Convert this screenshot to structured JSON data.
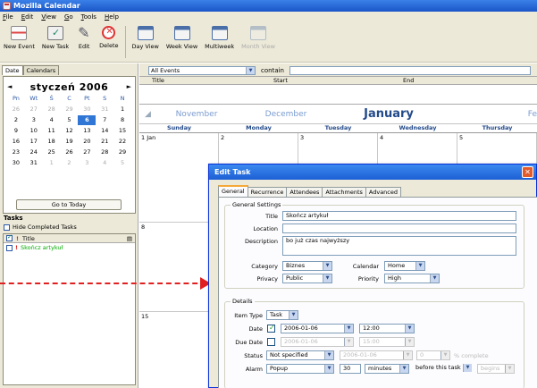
{
  "window": {
    "title": "Mozilla Calendar"
  },
  "menu": [
    "File",
    "Edit",
    "View",
    "Go",
    "Tools",
    "Help"
  ],
  "toolbar": {
    "new_event": "New Event",
    "new_task": "New Task",
    "edit": "Edit",
    "delete": "Delete",
    "day_view": "Day View",
    "week_view": "Week View",
    "multiweek": "Multiweek",
    "month_view": "Month View"
  },
  "left_tabs": [
    "Date",
    "Calendars"
  ],
  "mini_calendar": {
    "title": "styczeń  2006",
    "prev": "◄",
    "next": "►",
    "dow": [
      "Pn",
      "Wt",
      "Ś",
      "C",
      "Pt",
      "S",
      "N"
    ],
    "weeks": [
      [
        {
          "d": "26",
          "dim": true
        },
        {
          "d": "27",
          "dim": true
        },
        {
          "d": "28",
          "dim": true
        },
        {
          "d": "29",
          "dim": true
        },
        {
          "d": "30",
          "dim": true
        },
        {
          "d": "31",
          "dim": true
        },
        {
          "d": "1"
        }
      ],
      [
        {
          "d": "2"
        },
        {
          "d": "3"
        },
        {
          "d": "4"
        },
        {
          "d": "5"
        },
        {
          "d": "6",
          "sel": true
        },
        {
          "d": "7"
        },
        {
          "d": "8"
        }
      ],
      [
        {
          "d": "9"
        },
        {
          "d": "10"
        },
        {
          "d": "11"
        },
        {
          "d": "12"
        },
        {
          "d": "13"
        },
        {
          "d": "14"
        },
        {
          "d": "15"
        }
      ],
      [
        {
          "d": "16"
        },
        {
          "d": "17"
        },
        {
          "d": "18"
        },
        {
          "d": "19"
        },
        {
          "d": "20"
        },
        {
          "d": "21"
        },
        {
          "d": "22"
        }
      ],
      [
        {
          "d": "23"
        },
        {
          "d": "24"
        },
        {
          "d": "25"
        },
        {
          "d": "26"
        },
        {
          "d": "27"
        },
        {
          "d": "28"
        },
        {
          "d": "29"
        }
      ],
      [
        {
          "d": "30"
        },
        {
          "d": "31"
        },
        {
          "d": "1",
          "dim": true
        },
        {
          "d": "2",
          "dim": true
        },
        {
          "d": "3",
          "dim": true
        },
        {
          "d": "4",
          "dim": true
        },
        {
          "d": "5",
          "dim": true
        }
      ]
    ],
    "go_to_today": "Go to Today"
  },
  "tasks": {
    "heading": "Tasks",
    "hide_completed": "Hide Completed Tasks",
    "col_priority": "!",
    "col_title": "Title",
    "items": [
      {
        "priority": "!",
        "title": "Skończ artykuł"
      }
    ]
  },
  "filter": {
    "scope": "All Events",
    "operator": "contain",
    "text": ""
  },
  "list_columns": [
    "Title",
    "Start",
    "End"
  ],
  "month_nav": {
    "prev2": "November",
    "prev": "December",
    "current": "January",
    "next": "Fe"
  },
  "weekdays": [
    "Sunday",
    "Monday",
    "Tuesday",
    "Wednesday",
    "Thursday"
  ],
  "month_cells": [
    [
      "1 Jan",
      "2",
      "3",
      "4",
      "5"
    ],
    [
      "8",
      "",
      "",
      "",
      ""
    ],
    [
      "15",
      "",
      "",
      "",
      ""
    ]
  ],
  "dialog": {
    "title": "Edit Task",
    "close": "✕",
    "tabs": [
      "General",
      "Recurrence",
      "Attendees",
      "Attachments",
      "Advanced"
    ],
    "general_settings": {
      "legend": "General Settings",
      "title_label": "Title",
      "title_value": "Skończ artykuł",
      "location_label": "Location",
      "location_value": "",
      "description_label": "Description",
      "description_value": "bo już czas najwyższy",
      "category_label": "Category",
      "category_value": "Biznes",
      "calendar_label": "Calendar",
      "calendar_value": "Home",
      "privacy_label": "Privacy",
      "privacy_value": "Public",
      "priority_label": "Priority",
      "priority_value": "High"
    },
    "details": {
      "legend": "Details",
      "item_type_label": "Item Type",
      "item_type_value": "Task",
      "date_label": "Date",
      "date_value": "2006-01-06",
      "date_time": "12:00",
      "due_date_label": "Due Date",
      "due_date_value": "2006-01-06",
      "due_time": "15:00",
      "status_label": "Status",
      "status_value": "Not specified",
      "status_date": "2006-01-06",
      "percent_value": "0",
      "percent_label": "% complete",
      "alarm_label": "Alarm",
      "alarm_value": "Popup",
      "alarm_amount": "30",
      "alarm_units": "minutes",
      "alarm_relation": "before this task",
      "alarm_anchor": "begins"
    }
  },
  "colors": {
    "accent": "#2f76d5",
    "titlebar": "#1a56c8",
    "annotation": "#e02020"
  }
}
